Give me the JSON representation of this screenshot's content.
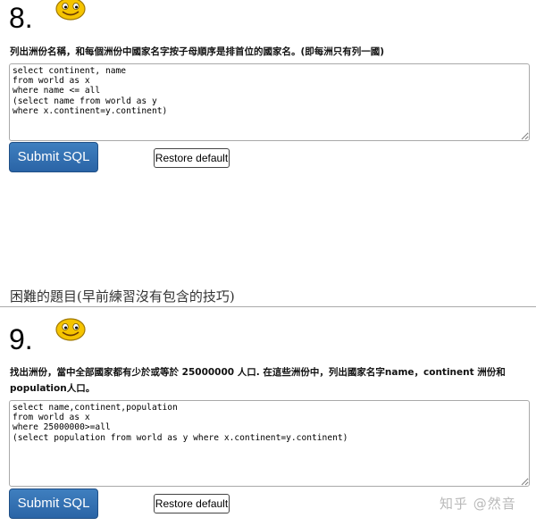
{
  "q8": {
    "number": "8.",
    "smiley_icon": "smiley-face-icon",
    "prompt": "列出洲份名稱，和每個洲份中國家名字按子母順序是排首位的國家名。(即每洲只有列一國)",
    "sql": "select continent, name\nfrom world as x\nwhere name <= all\n(select name from world as y\nwhere x.continent=y.continent)",
    "submit_label": "Submit SQL",
    "restore_label": "Restore default"
  },
  "hard_section": {
    "heading": "困難的題目(早前練習沒有包含的技巧)"
  },
  "q9": {
    "number": "9.",
    "smiley_icon": "smiley-face-icon",
    "prompt_line1": "找出洲份，當中全部國家都有少於或等於 25000000 人口. 在這些洲份中，列出國家名字name，continent 洲份和",
    "prompt_line2": "population人口。",
    "sql": "select name,continent,population\nfrom world as x\nwhere 25000000>=all\n(select population from world as y where x.continent=y.continent)",
    "submit_label": "Submit SQL",
    "restore_label": "Restore default"
  },
  "watermark": "知乎 @然音",
  "colors": {
    "submit_button": "#2f6db0",
    "smiley_face": "#f5c400",
    "section_rule": "#aaaaaa"
  }
}
